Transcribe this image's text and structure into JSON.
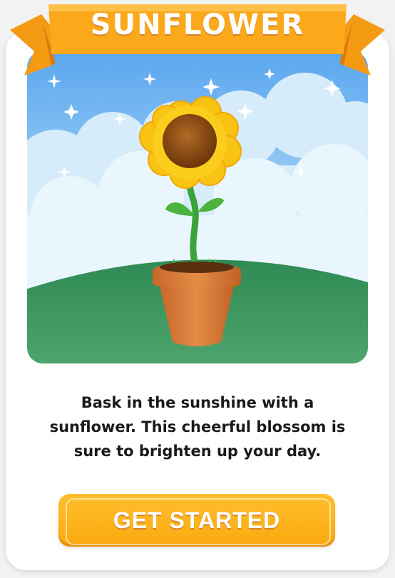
{
  "title": "SUNFLOWER",
  "description": "Bask in the sunshine with a sunflower. This cheerful blossom is sure to brighten up your day.",
  "cta_label": "GET STARTED",
  "colors": {
    "banner": "#fba91b",
    "banner_dark": "#e8890f",
    "button": "#fbb018",
    "sky_top": "#5aa6ef",
    "cloud": "#d7ecfa",
    "grass": "#3f9a63",
    "pot": "#d87a36",
    "petals": "#f9c313",
    "flower_center": "#8a4b16"
  }
}
